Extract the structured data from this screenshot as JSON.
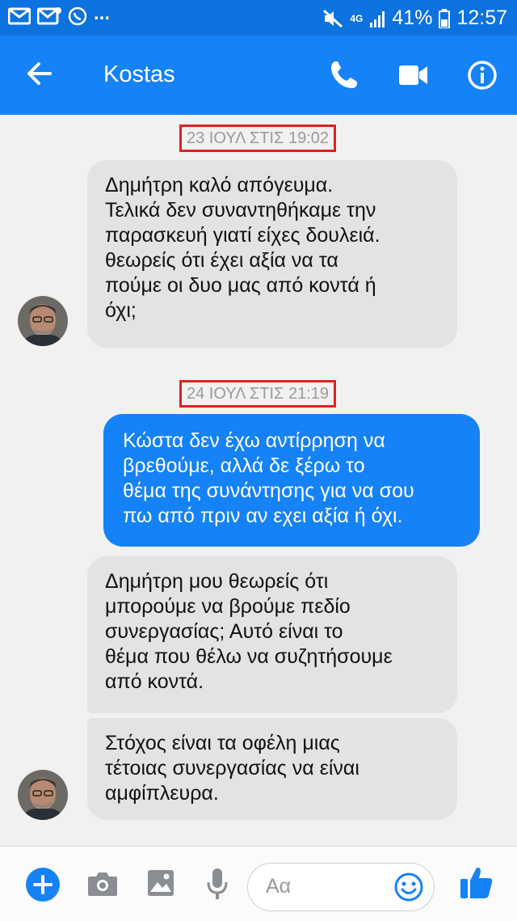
{
  "status_bar": {
    "network": "4G",
    "battery": "41%",
    "time": "12:57",
    "dots": "..."
  },
  "header": {
    "back_icon": "arrow-left-icon",
    "contact_name": "Kostas",
    "call_icon": "phone-icon",
    "video_icon": "video-camera-icon",
    "info_icon": "info-icon"
  },
  "messages": {
    "ts1": "23 ΙΟΥΛ ΣΤΙΣ 19:02",
    "m1": [
      "Δημήτρη καλό απόγευμα.",
      "Τελικά δεν συναντηθήκαμε την",
      "παρασκευή γιατί είχες δουλειά.",
      "θεωρείς ότι έχει αξία να τα",
      "πούμε οι δυο μας από κοντά ή",
      "όχι;"
    ],
    "ts2": "24 ΙΟΥΛ ΣΤΙΣ 21:19",
    "m2": [
      "Κώστα δεν έχω αντίρρηση να",
      "βρεθούμε, αλλά δε ξέρω το",
      "θέμα της συνάντησης για να σου",
      "πω από πριν αν εχει αξία ή όχι."
    ],
    "m3": [
      "Δημήτρη μου θεωρείς ότι",
      "μπορούμε να βρούμε πεδίο",
      "συνεργασίας; Αυτό είναι το",
      "θέμα που θέλω να συζητήσουμε",
      "από κοντά."
    ],
    "m4": [
      "Στόχος είναι τα οφέλη μιας",
      "τέτοιας συνεργασίας να είναι",
      "αμφίπλευρα."
    ]
  },
  "composer": {
    "placeholder": "Αα",
    "icons": [
      "plus-icon",
      "camera-icon",
      "image-icon",
      "microphone-icon",
      "emoji-icon",
      "thumbs-up-icon"
    ]
  },
  "colors": {
    "accent": "#1582f7",
    "status_bar": "#0b72df",
    "incoming_bubble": "#e3e3e3",
    "timestamp_box": "#e02020"
  }
}
